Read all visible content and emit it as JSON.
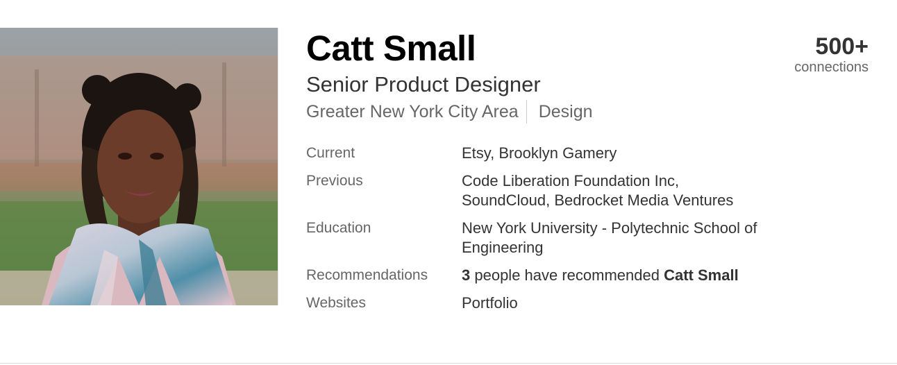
{
  "profile": {
    "name": "Catt Small",
    "headline": "Senior Product Designer",
    "location": "Greater New York City Area",
    "industry": "Design"
  },
  "connections": {
    "count": "500+",
    "label": "connections"
  },
  "details": {
    "current": {
      "label": "Current",
      "value": "Etsy, Brooklyn Gamery"
    },
    "previous": {
      "label": "Previous",
      "value": "Code Liberation Foundation Inc, SoundCloud, Bedrocket Media Ventures"
    },
    "education": {
      "label": "Education",
      "value": "New York University - Polytechnic School of Engineering"
    },
    "recommendations": {
      "label": "Recommendations",
      "count": "3",
      "text": " people have recommended ",
      "name": "Catt Small"
    },
    "websites": {
      "label": "Websites",
      "value": "Portfolio"
    }
  },
  "colors": {
    "name": "#000000",
    "text": "#333333",
    "muted": "#666666",
    "divider": "#cccccc"
  }
}
